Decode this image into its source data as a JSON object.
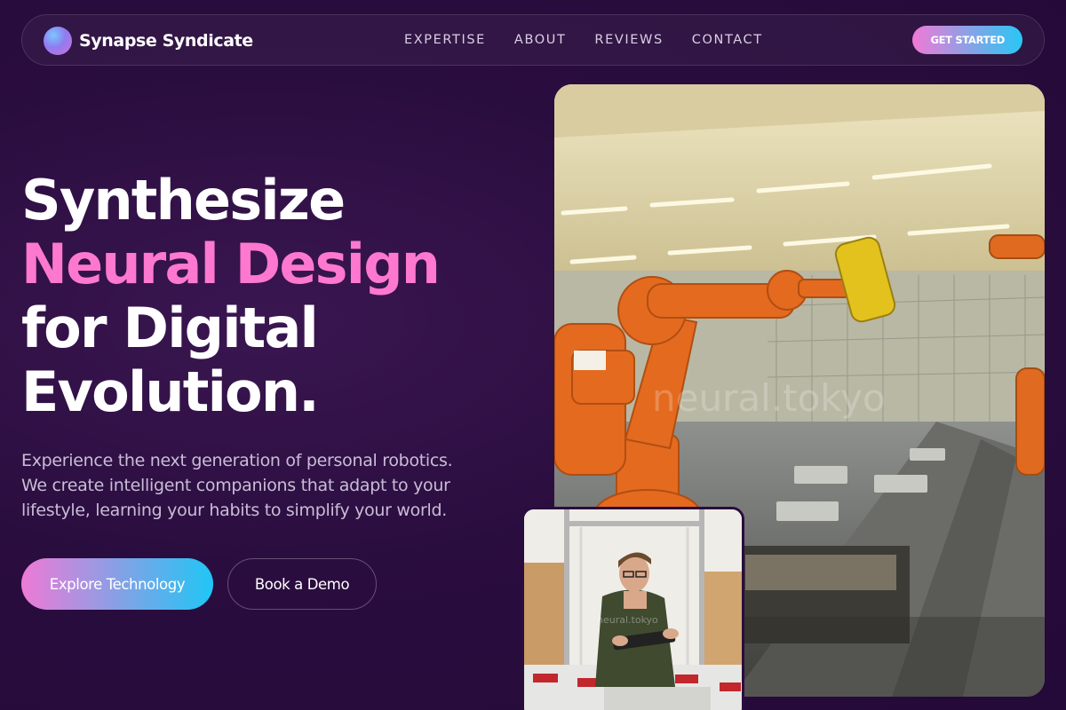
{
  "brand": {
    "name": "Synapse Syndicate",
    "icon": "gradient-orb-logo"
  },
  "nav": {
    "items": [
      {
        "label": "EXPERTISE"
      },
      {
        "label": "ABOUT"
      },
      {
        "label": "REVIEWS"
      },
      {
        "label": "CONTACT"
      }
    ],
    "cta_label": "GET STARTED"
  },
  "hero": {
    "headline": {
      "line1": "Synthesize",
      "line2": "Neural Design",
      "line3": "for Digital",
      "line4": "Evolution."
    },
    "subtext": {
      "line1": "Experience the next generation of personal robotics.",
      "line2": "We create intelligent companions that adapt to your",
      "line3": "lifestyle, learning your habits to simplify your world."
    },
    "primary_button": "Explore Technology",
    "secondary_button": "Book a Demo"
  },
  "images": {
    "main_watermark": "neural.tokyo",
    "small_watermark": "neural.tokyo"
  },
  "colors": {
    "background": "#240a38",
    "accent_pink": "#ff78cf",
    "gradient_start": "#ee7ad6",
    "gradient_end": "#20c6f5"
  }
}
